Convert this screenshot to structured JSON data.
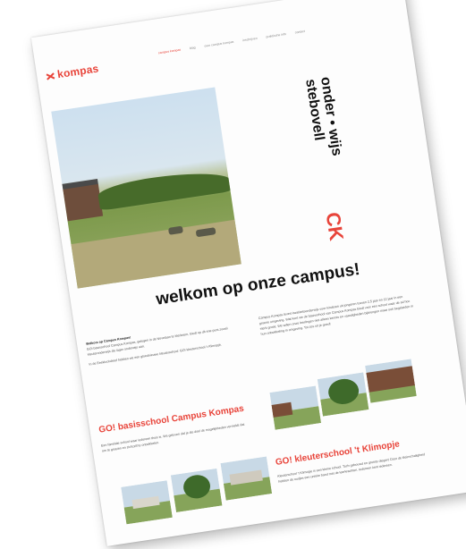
{
  "logo": {
    "text": "kompas"
  },
  "nav": [
    "campus kompas",
    "blog",
    "over campus kompas",
    "inschrijven",
    "praktische info",
    "contact"
  ],
  "hero": {
    "title_line1": "onder • wijs",
    "title_line2": "stebovell",
    "badge": "CK"
  },
  "welcome": {
    "heading": "welkom op onze campus!"
  },
  "intro_left": {
    "p1_lead": "Welkom op Campus Kompas!",
    "p1": "GO! basisschool Campus Kompas, gelegen in de Nevelaan te Merksem, biedt op dit ene punt zowel kleuteronderwijs als lager onderwijs aan.",
    "p2": "In de Eeeklockdreef hebben we een gloednieuwe kleuterschool: GO! kleuterschool 't Klimopje."
  },
  "intro_right": {
    "p1": "Campus Kompas levert kwaliteitsonderwijs voor kinderen uit jongeren tussen 2,5 jaar en 12 jaar in een groene omgeving. Wat kunt we de basisschool van Campus Kompas biedt voor een school waar de ad hoc sterk groeit. We willen onze leerlingen niet alleen kennis en vaardigheden bijbrengen maar ook begeleiden in hun ontwikkeling in omgeving. Tot zes uit je goed!"
  },
  "section_basis": {
    "title": "GO! basisschool Campus Kompas",
    "text": "Een familiale school waar iedereen thuis is. We geloven dat je als doel de mogelijkheden vermeldt dat om te groeien en zichzelf te ontwikkelen."
  },
  "section_kleuter": {
    "title": "GO! kleuterschool 't Klimopje",
    "text": "Kleuterschool 't Klimopje is een kleine school. Toch gebouwd en groeits diegen! Door de kleinschaligheid hebben de oudjes een unieke band met de leerkrachten. Iedereen kent iedereen."
  },
  "colors": {
    "accent": "#e8443a",
    "text": "#111111"
  }
}
